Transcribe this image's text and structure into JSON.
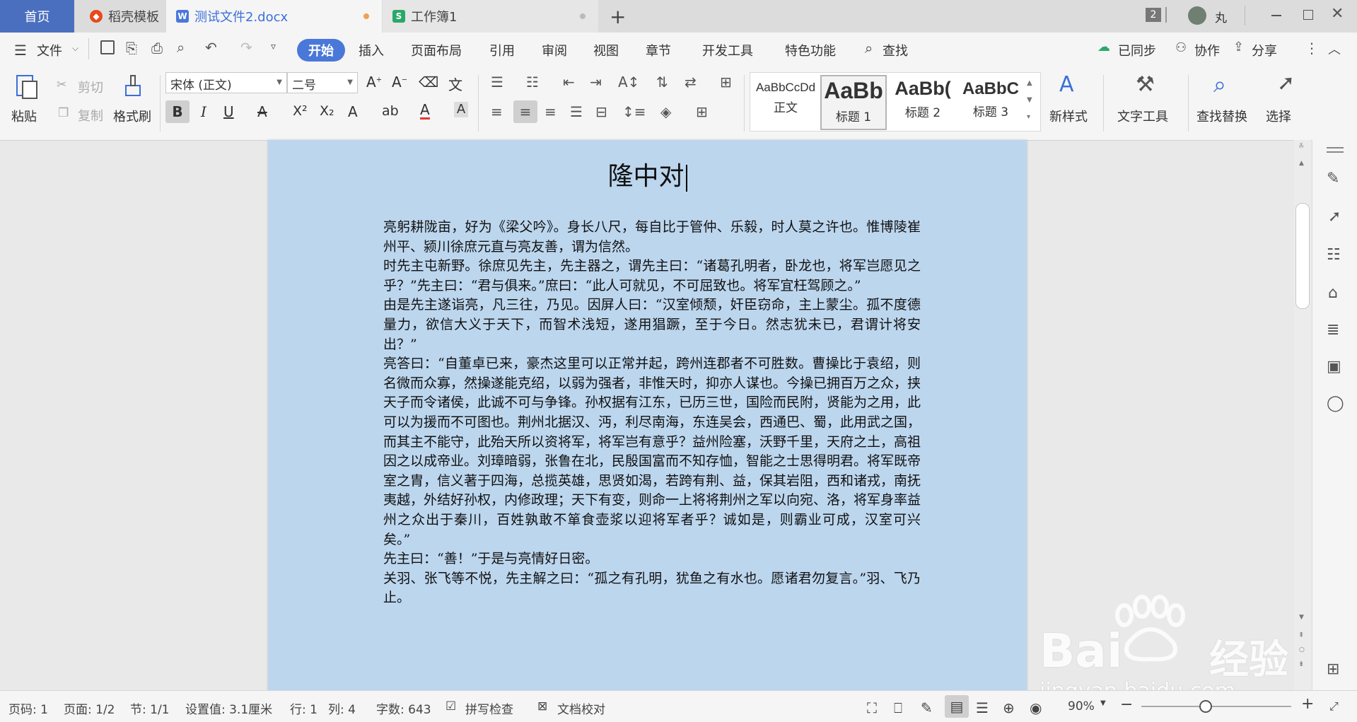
{
  "tabs": {
    "home": "首页",
    "tab1": "稻壳模板",
    "tab2": "测试文件2.docx",
    "tab3": "工作簿1",
    "new_tab": "+",
    "count_badge": "2",
    "user_name": "丸"
  },
  "menu": {
    "file": "文件",
    "items": [
      "开始",
      "插入",
      "页面布局",
      "引用",
      "审阅",
      "视图",
      "章节",
      "开发工具",
      "特色功能"
    ],
    "search": "查找",
    "synced": "已同步",
    "collab": "协作",
    "share": "分享"
  },
  "ribbon": {
    "paste": "粘贴",
    "cut": "剪切",
    "copy": "复制",
    "format_painter": "格式刷",
    "font_name": "宋体 (正文)",
    "font_size": "二号",
    "styles": [
      {
        "sample": "AaBbCcDd",
        "name": "正文"
      },
      {
        "sample": "AaBb",
        "name": "标题 1"
      },
      {
        "sample": "AaBb(",
        "name": "标题 2"
      },
      {
        "sample": "AaBbC",
        "name": "标题 3"
      }
    ],
    "new_style": "新样式",
    "text_tools": "文字工具",
    "find_replace": "查找替换",
    "select": "选择"
  },
  "document": {
    "title": "隆中对",
    "paragraphs": [
      "亮躬耕陇亩，好为《梁父吟》。身长八尺，每自比于管仲、乐毅，时人莫之许也。惟博陵崔州平、颍川徐庶元直与亮友善，谓为信然。",
      "时先主屯新野。徐庶见先主，先主器之，谓先主曰：“诸葛孔明者，卧龙也，将军岂愿见之乎？”先主曰：“君与俱来。”庶曰：“此人可就见，不可屈致也。将军宜枉驾顾之。”",
      "由是先主遂诣亮，凡三往，乃见。因屏人曰：“汉室倾颓，奸臣窃命，主上蒙尘。孤不度德量力，欲信大义于天下，而智术浅短，遂用猖蹶，至于今日。然志犹未已，君谓计将安出？”",
      "亮答曰：“自董卓已来，豪杰这里可以正常并起，跨州连郡者不可胜数。曹操比于袁绍，则名微而众寡，然操遂能克绍，以弱为强者，非惟天时，抑亦人谋也。今操已拥百万之众，挟天子而令诸侯，此诚不可与争锋。孙权据有江东，已历三世，国险而民附，贤能为之用，此可以为援而不可图也。荆州北据汉、沔，利尽南海，东连吴会，西通巴、蜀，此用武之国，而其主不能守，此殆天所以资将军，将军岂有意乎？益州险塞，沃野千里，天府之土，高祖因之以成帝业。刘璋暗弱，张鲁在北，民殷国富而不知存恤，智能之士思得明君。将军既帝室之胄，信义著于四海，总揽英雄，思贤如渴，若跨有荆、益，保其岩阻，西和诸戎，南抚夷越，外结好孙权，内修政理；天下有变，则命一上将将荆州之军以向宛、洛，将军身率益州之众出于秦川，百姓孰敢不箪食壶浆以迎将军者乎？诚如是，则霸业可成，汉室可兴矣。”",
      "先主曰：“善！”于是与亮情好日密。",
      "关羽、张飞等不悦，先主解之曰：“孤之有孔明，犹鱼之有水也。愿诸君勿复言。”羽、飞乃止。"
    ]
  },
  "status": {
    "page_num": "页码: 1",
    "pages": "页面: 1/2",
    "section": "节: 1/1",
    "setting": "设置值: 3.1厘米",
    "row": "行: 1",
    "col": "列: 4",
    "word_count": "字数: 643",
    "spell_check": "拼写检查",
    "doc_proof": "文档校对",
    "zoom": "90%"
  },
  "watermark": {
    "brand": "Bai",
    "brand2": "经验",
    "url": "jingyan.baidu.com"
  },
  "colors": {
    "accent": "#4a78d9",
    "page_bg": "#bcd6ee",
    "app_bg": "#e9e9e9"
  }
}
